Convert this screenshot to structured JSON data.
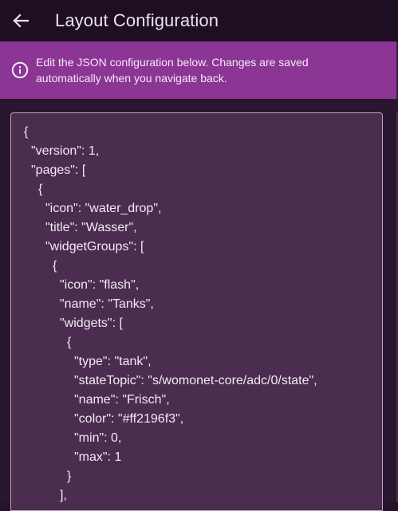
{
  "app_bar": {
    "title": "Layout Configuration",
    "back_icon": "arrow-left-icon"
  },
  "info_banner": {
    "icon": "info-icon",
    "message": "Edit the JSON configuration below. Changes are saved automatically when you navigate back."
  },
  "editor": {
    "lines": [
      {
        "indent": 0,
        "text": "{"
      },
      {
        "indent": 1,
        "text": "\"version\": 1,"
      },
      {
        "indent": 1,
        "text": "\"pages\": ["
      },
      {
        "indent": 2,
        "text": "{"
      },
      {
        "indent": 3,
        "text": "\"icon\": \"water_drop\","
      },
      {
        "indent": 3,
        "text": "\"title\": \"Wasser\","
      },
      {
        "indent": 3,
        "text": "\"widgetGroups\": ["
      },
      {
        "indent": 4,
        "text": "{"
      },
      {
        "indent": 5,
        "text": "\"icon\": \"flash\","
      },
      {
        "indent": 5,
        "text": "\"name\": \"Tanks\","
      },
      {
        "indent": 5,
        "text": "\"widgets\": ["
      },
      {
        "indent": 6,
        "text": "{"
      },
      {
        "indent": 7,
        "text": "\"type\": \"tank\","
      },
      {
        "indent": 7,
        "text": "\"stateTopic\": \"s/womonet-core/adc/0/state\","
      },
      {
        "indent": 7,
        "text": "\"name\": \"Frisch\","
      },
      {
        "indent": 7,
        "text": "\"color\": \"#ff2196f3\","
      },
      {
        "indent": 7,
        "text": "\"min\": 0,"
      },
      {
        "indent": 7,
        "text": "\"max\": 1"
      },
      {
        "indent": 6,
        "text": "}"
      },
      {
        "indent": 5,
        "text": "],"
      }
    ]
  }
}
